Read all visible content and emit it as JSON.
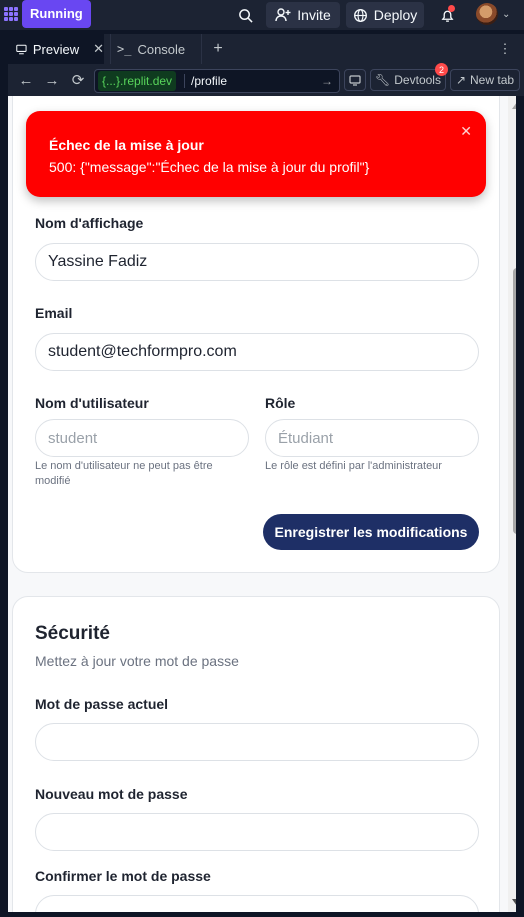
{
  "topbar": {
    "run_label": "Running",
    "invite_label": "Invite",
    "deploy_label": "Deploy"
  },
  "tabs": {
    "preview_label": "Preview",
    "console_label": "Console"
  },
  "urlbar": {
    "host": "{...}.replit.dev",
    "path": "/profile",
    "devtools_label": "Devtools",
    "devtools_badge": "2",
    "newtab_label": "New tab"
  },
  "toast": {
    "title": "Échec de la mise à jour",
    "message": "500: {\"message\":\"Échec de la mise à jour du profil\"}"
  },
  "profile_form": {
    "display_name_label": "Nom d'affichage",
    "display_name_value": "Yassine Fadiz",
    "email_label": "Email",
    "email_value": "student@techformpro.com",
    "username_label": "Nom d'utilisateur",
    "username_value": "student",
    "username_hint": "Le nom d'utilisateur ne peut pas être modifié",
    "role_label": "Rôle",
    "role_value": "Étudiant",
    "role_hint": "Le rôle est défini par l'administrateur",
    "save_label": "Enregistrer les modifications"
  },
  "security": {
    "title": "Sécurité",
    "subtitle": "Mettez à jour votre mot de passe",
    "current_label": "Mot de passe actuel",
    "new_label": "Nouveau mot de passe",
    "confirm_label": "Confirmer le mot de passe"
  },
  "colors": {
    "accent": "#6947f2",
    "toast_bg": "#ff0000",
    "primary_button": "#1e2f66"
  }
}
